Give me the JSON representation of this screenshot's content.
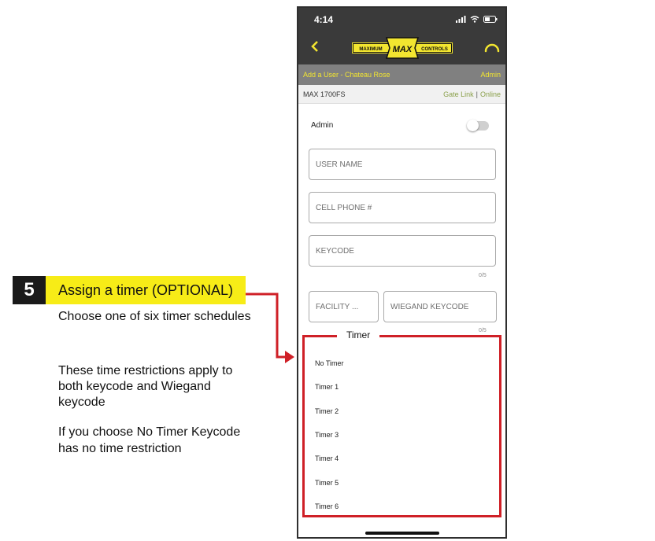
{
  "instructions": {
    "step_number": "5",
    "step_title": "Assign a timer (OPTIONAL)",
    "note_1": "Choose one of six timer schedules",
    "note_2": "These time restrictions apply to both keycode and Wiegand keycode",
    "note_3": "If you choose No Timer Keycode has no time restriction"
  },
  "status_bar": {
    "time": "4:14"
  },
  "header": {
    "logo_left": "MAXIMUM",
    "logo_center": "MAX",
    "logo_right": "CONTROLS"
  },
  "sub_bar": {
    "title": "Add a User - Chateau Rose",
    "role": "Admin"
  },
  "device_bar": {
    "device": "MAX 1700FS",
    "link": "Gate Link",
    "separator": "|",
    "status": "Online"
  },
  "form": {
    "admin_label": "Admin",
    "admin_toggle_on": false,
    "user_name_placeholder": "USER NAME",
    "cell_phone_placeholder": "CELL PHONE #",
    "keycode_placeholder": "KEYCODE",
    "keycode_counter": "0/5",
    "facility_placeholder": "FACILITY ...",
    "wiegand_placeholder": "WIEGAND KEYCODE",
    "wiegand_counter": "0/5"
  },
  "timer_dropdown": {
    "title": "Timer",
    "options": [
      "No Timer",
      "Timer 1",
      "Timer 2",
      "Timer 3",
      "Timer 4",
      "Timer 5",
      "Timer 6"
    ]
  },
  "colors": {
    "highlight_yellow": "#f7ec17",
    "callout_red": "#cf2027",
    "brand_yellow": "#f2e530",
    "status_green": "#8aa04a"
  }
}
